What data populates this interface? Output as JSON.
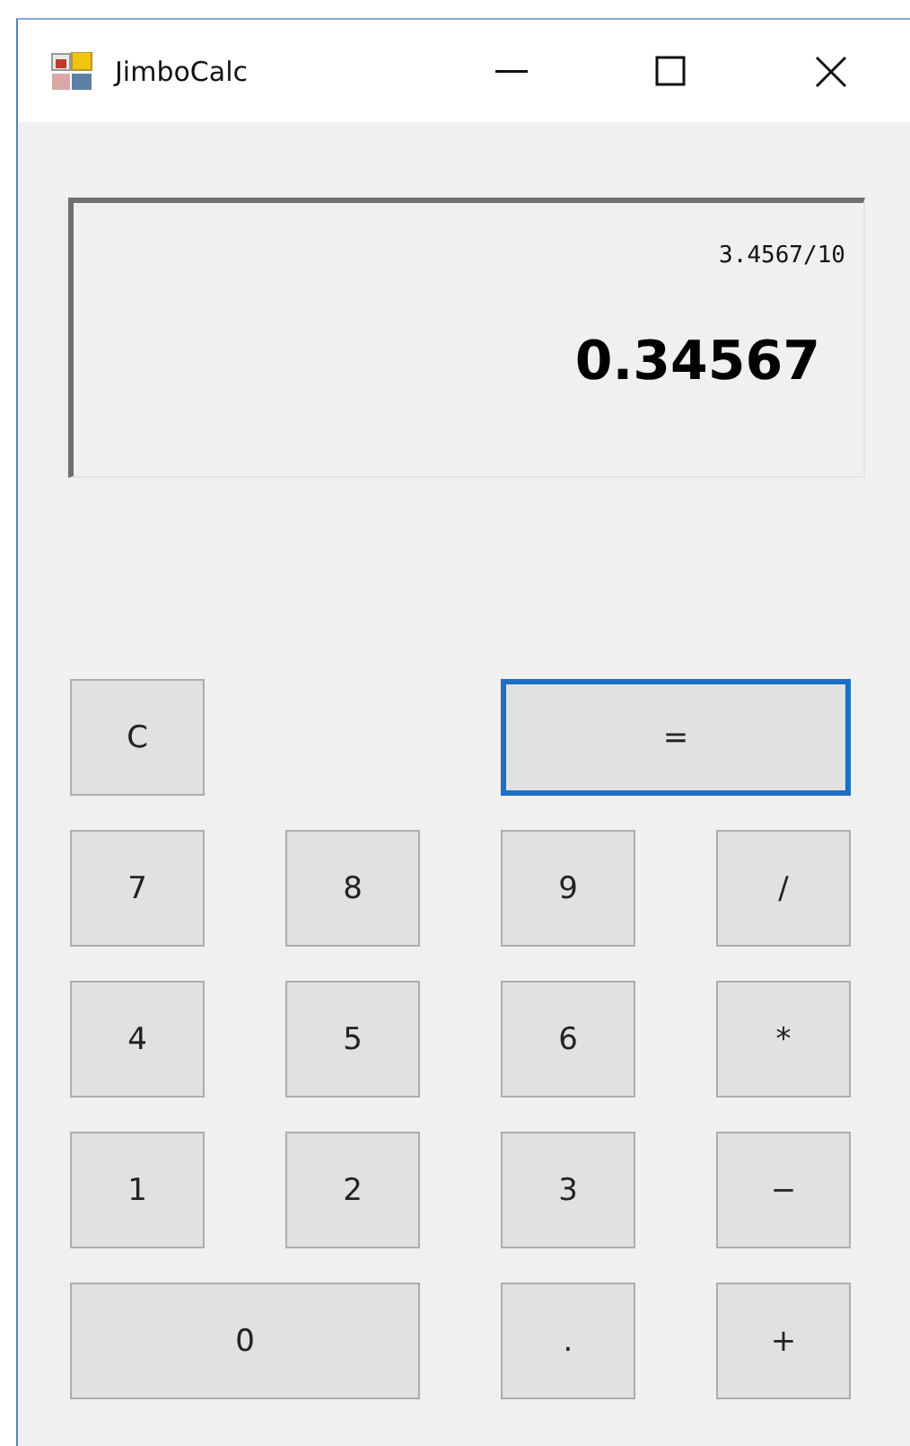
{
  "window": {
    "title": "JimboCalc"
  },
  "display": {
    "expression": "3.4567/10",
    "result": "0.34567"
  },
  "keypad": [
    [
      {
        "label": "C",
        "kind": "single",
        "focused": false
      },
      {
        "label": "=",
        "kind": "wide",
        "focused": true
      }
    ],
    [
      {
        "label": "7",
        "kind": "single",
        "focused": false
      },
      {
        "label": "8",
        "kind": "single",
        "focused": false
      },
      {
        "label": "9",
        "kind": "single",
        "focused": false
      },
      {
        "label": "/",
        "kind": "single",
        "focused": false
      }
    ],
    [
      {
        "label": "4",
        "kind": "single",
        "focused": false
      },
      {
        "label": "5",
        "kind": "single",
        "focused": false
      },
      {
        "label": "6",
        "kind": "single",
        "focused": false
      },
      {
        "label": "*",
        "kind": "single",
        "focused": false
      }
    ],
    [
      {
        "label": "1",
        "kind": "single",
        "focused": false
      },
      {
        "label": "2",
        "kind": "single",
        "focused": false
      },
      {
        "label": "3",
        "kind": "single",
        "focused": false
      },
      {
        "label": "−",
        "kind": "single",
        "focused": false
      }
    ],
    [
      {
        "label": "0",
        "kind": "wide",
        "focused": false
      },
      {
        "label": ".",
        "kind": "single",
        "focused": false
      },
      {
        "label": "+",
        "kind": "single",
        "focused": false
      }
    ]
  ]
}
